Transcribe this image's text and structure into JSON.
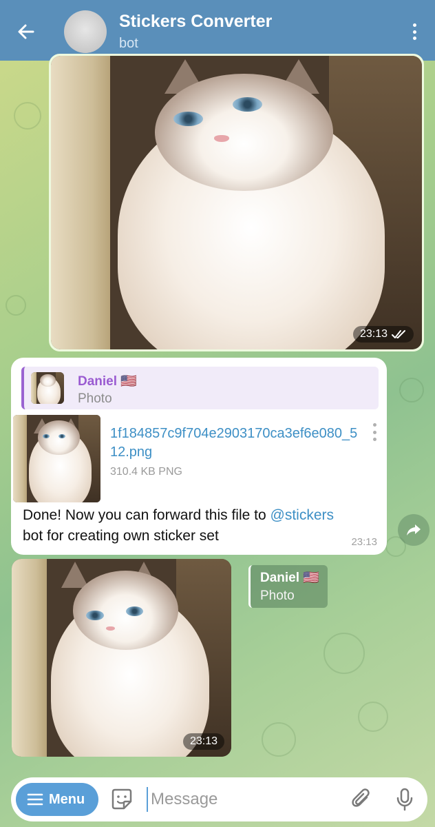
{
  "header": {
    "title": "Stickers Converter",
    "subtitle": "bot",
    "back_icon": "arrow-left-icon",
    "more_icon": "more-vertical-icon"
  },
  "outgoing_photo": {
    "time": "23:13",
    "status_icon": "double-check-icon"
  },
  "file_message": {
    "reply": {
      "sender": "Daniel 🇺🇸",
      "text": "Photo"
    },
    "file": {
      "name": "1f184857c9f704e2903170ca3ef6e080_512.png",
      "size": "310.4 KB PNG"
    },
    "text_before": "Done! Now you can forward this file to ",
    "mention": "@stickers",
    "text_after": " bot for creating own sticker set",
    "time": "23:13"
  },
  "forward_button": {
    "icon": "share-arrow-icon"
  },
  "incoming_photo": {
    "time": "23:13",
    "forwarded_from": {
      "sender": "Daniel 🇺🇸",
      "text": "Photo"
    }
  },
  "input_bar": {
    "menu_label": "Menu",
    "placeholder": "Message",
    "sticker_icon": "sticker-icon",
    "attach_icon": "paperclip-icon",
    "mic_icon": "microphone-icon"
  },
  "colors": {
    "header_bg": "#5a8fba",
    "link": "#3d8fc5",
    "reply_accent": "#9a63d1",
    "menu_button": "#5a9fd8"
  }
}
